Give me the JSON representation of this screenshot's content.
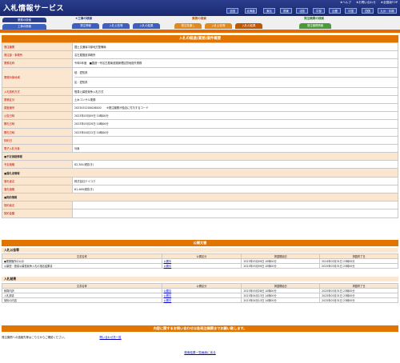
{
  "header": {
    "logo": "入札情報サービス",
    "toplinks": [
      "★ヘルプ",
      "★お問い合わせ",
      "★全国版TOP"
    ],
    "regions": [
      "全国",
      "北海道",
      "東北",
      "関東",
      "北陸",
      "中部",
      "近畿",
      "中国",
      "四国",
      "九州・沖縄"
    ]
  },
  "tabbar": {
    "groups": [
      {
        "title": "★工事の検索",
        "color": "#2a3c8c"
      },
      {
        "title": "業務の検索",
        "color": "#c05800"
      },
      {
        "title": "発注機関の検索",
        "color": "#2a7a2a"
      }
    ],
    "tabs": [
      "発注情報",
      "入札公告等",
      "入札の結果",
      "発注見通し",
      "入札公告等",
      "入札の結果",
      "発注機関情報"
    ],
    "left_tabs": [
      "工事の検索",
      "業務の検索"
    ]
  },
  "detail": {
    "title": "入札の経過(業務)案件概要",
    "rows": [
      {
        "label": "発注機関",
        "value": "国土交通省中部地方整備局"
      },
      {
        "label": "発注部・事務所",
        "value": "名古屋国道事務所"
      },
      {
        "label": "業務名称",
        "value": "令和5年度　■国道一号名古屋南道路管理区間地道外業務"
      },
      {
        "label": "業務対象地域",
        "value": [
          "岐：愛知県",
          "区：愛知県"
        ]
      },
      {
        "label": "入札契約方式",
        "value": "簡易公募型競争入札方式"
      },
      {
        "label": "業務区分",
        "value": "土木コンサル業務"
      },
      {
        "label": "調査番号",
        "value": "2023052200026000　　※発注機関が独自に付与するコード"
      },
      {
        "label": "公告日時",
        "value": "2023年03月09日 10時00分"
      },
      {
        "label": "開札日時",
        "value": "2023年03月28日 10時00分"
      },
      {
        "label": "開札日時",
        "value": "2023年04月12日 10時00分"
      },
      {
        "label": "特約日",
        "value": ""
      },
      {
        "label": "電子入札対象",
        "value": "対象"
      }
    ],
    "sections": {
      "price": "■予定価格情報",
      "price_label": "予定価格",
      "price_value": "82,361(税抜き)",
      "winner": "■落札者情報",
      "winner_label1": "落札者名",
      "winner_value1": "株式会社テイコク",
      "winner_label2": "落札価格",
      "winner_value2": "61,469(税抜き)",
      "contract": "■契約情報",
      "contract_label1": "契約者名",
      "contract_label2": "契約金額"
    }
  },
  "docs": {
    "title": "公開文書",
    "group1": "入札公告等",
    "group2": "入札結果",
    "headers": [
      "文書名称",
      "公開区分",
      "掲載開始日",
      "掲載終了日"
    ],
    "rows1": [
      [
        "●業務箇所の公示",
        "公開中",
        "2023年03月09日 10時00分",
        "2024年03月31日 23時00分"
      ],
      [
        "公募型・簡易公募型競争入札の指名結果書",
        "公開中",
        "2023年03月09日 10時00分",
        "2025年03月31日 23時00分"
      ]
    ],
    "rows2": [
      [
        "積算内訳",
        "公開中",
        "2023年03月28日 10時00分",
        "2025年03月31日 23時00分"
      ],
      [
        "入札調書",
        "公開中",
        "2023年04月13日 14時00分",
        "2025年03月31日 23時00分"
      ],
      [
        "契約の内容",
        "公開中",
        "2023年04月13日 14時00分",
        "2025年03月31日 23時00分"
      ]
    ]
  },
  "contact": {
    "title": "内容に関するお問い合わせは各発注機関までお願い致します。",
    "text": "発注機関への連絡先等はこちらからご確認ください。",
    "link": "問い合わせ先一覧",
    "back": "検索結果一覧画面に戻る"
  }
}
